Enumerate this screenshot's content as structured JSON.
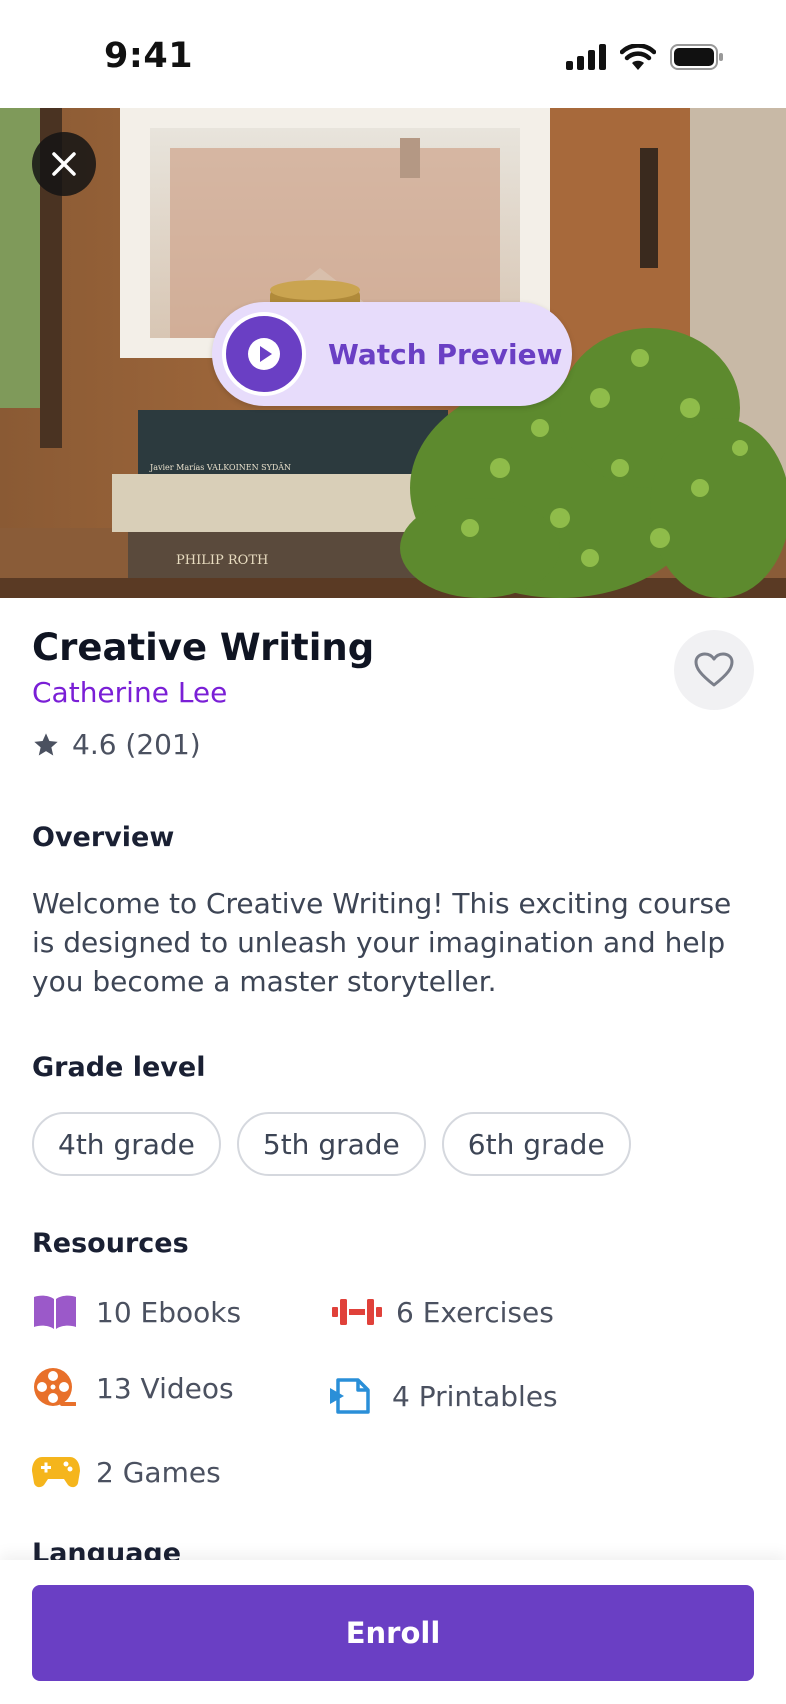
{
  "status_bar": {
    "time": "9:41"
  },
  "hero": {
    "preview_label": "Watch Preview",
    "book_spines": [
      "Javier Marías  VALKOINEN SYDÄN",
      "PHILIP ROTH"
    ]
  },
  "course": {
    "title": "Creative Writing",
    "author": "Catherine Lee",
    "rating": "4.6 (201)"
  },
  "overview": {
    "heading": "Overview",
    "text": "Welcome to Creative Writing! This exciting course is designed to unleash your imagination and help you become a master storyteller."
  },
  "grade_level": {
    "heading": "Grade level",
    "chips": [
      "4th grade",
      "5th grade",
      "6th grade"
    ]
  },
  "resources": {
    "heading": "Resources",
    "items": [
      {
        "label": "10 Ebooks",
        "icon": "book-icon",
        "color": "#9b59c9"
      },
      {
        "label": "6 Exercises",
        "icon": "dumbbell-icon",
        "color": "#e0413a"
      },
      {
        "label": "13 Videos",
        "icon": "film-reel-icon",
        "color": "#e8702a"
      },
      {
        "label": "4 Printables",
        "icon": "printable-icon",
        "color": "#2a8fd8"
      },
      {
        "label": "2 Games",
        "icon": "gamepad-icon",
        "color": "#f5b51c"
      }
    ]
  },
  "next_section": {
    "heading": "Language"
  },
  "actions": {
    "enroll_label": "Enroll"
  },
  "colors": {
    "accent": "#6a3fc4",
    "author": "#7a1fd6",
    "preview_bg": "#e7dcfb"
  }
}
